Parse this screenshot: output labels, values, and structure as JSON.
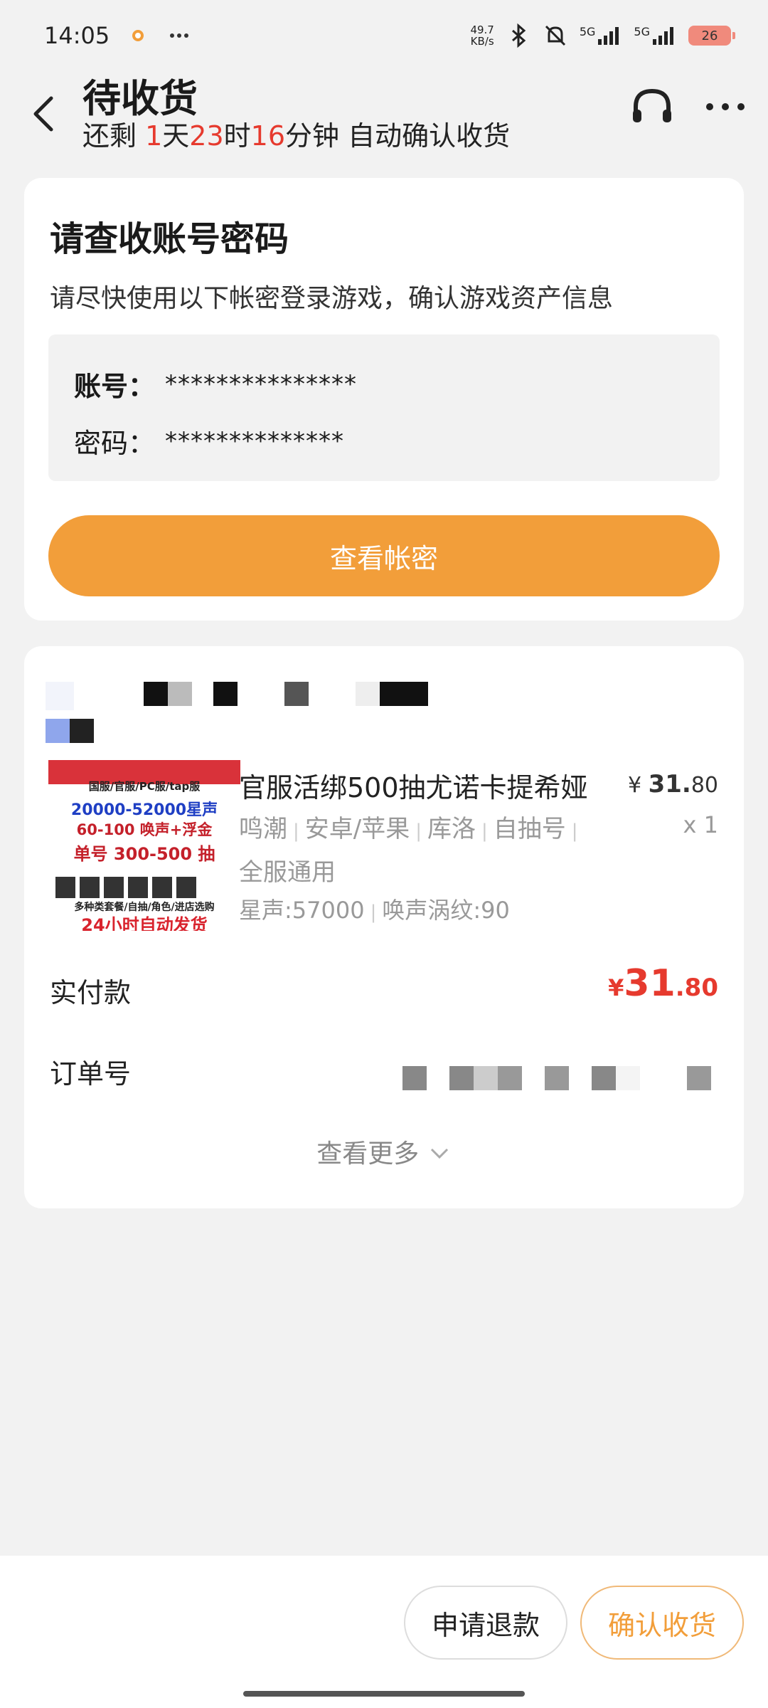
{
  "status_bar": {
    "time": "14:05",
    "netspeed_value": "49.7",
    "netspeed_unit": "KB/s",
    "signal1": "5G",
    "signal2": "5G",
    "battery": "26"
  },
  "header": {
    "title": "待收货",
    "sub_prefix": "还剩 ",
    "days": "1",
    "days_unit": "天",
    "hours": "23",
    "hours_unit": "时",
    "minutes": "16",
    "minutes_unit": "分钟 自动确认收货"
  },
  "credentials_card": {
    "title": "请查收账号密码",
    "description": "请尽快使用以下帐密登录游戏，确认游戏资产信息",
    "account_label": "账号：",
    "account_value": "***************",
    "password_label": "密码：",
    "password_value": "**************",
    "view_button": "查看帐密"
  },
  "order_card": {
    "product_image_text": {
      "line1": "国服/官服/PC服/tap服",
      "line2": "20000-52000星声",
      "line3": "60-100 唤声+浮金",
      "line4": "单号  300-500  抽",
      "line5": "多种类套餐/自抽/角色/进店选购",
      "line6": "24小时自动发货"
    },
    "product_title": "官服活绑500抽尤诺卡提希娅",
    "price_symbol": "¥",
    "price_int": "31.",
    "price_dec": "80",
    "quantity": "x 1",
    "tags": [
      "鸣潮",
      "安卓/苹果",
      "库洛",
      "自抽号",
      "全服通用"
    ],
    "stats": [
      "星声:57000",
      "唤声涡纹:90"
    ],
    "paid_label": "实付款",
    "paid_symbol": "¥",
    "paid_int": "31",
    "paid_dec": ".80",
    "order_label": "订单号",
    "see_more": "查看更多"
  },
  "bottom_bar": {
    "refund_button": "申请退款",
    "confirm_button": "确认收货"
  }
}
